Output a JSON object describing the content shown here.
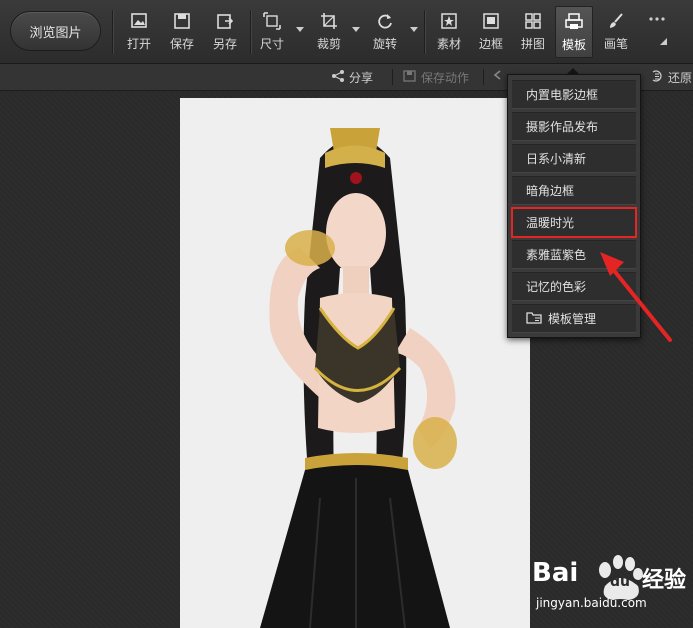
{
  "toolbar": {
    "browse_label": "浏览图片",
    "tools": [
      {
        "id": "open",
        "label": "打开",
        "icon": "image-open-icon"
      },
      {
        "id": "save",
        "label": "保存",
        "icon": "save-disk-icon"
      },
      {
        "id": "saveas",
        "label": "另存",
        "icon": "save-as-icon"
      },
      {
        "id": "size",
        "label": "尺寸",
        "icon": "resize-icon"
      },
      {
        "id": "crop",
        "label": "裁剪",
        "icon": "crop-icon"
      },
      {
        "id": "rotate",
        "label": "旋转",
        "icon": "rotate-icon"
      },
      {
        "id": "material",
        "label": "素材",
        "icon": "star-frame-icon"
      },
      {
        "id": "border",
        "label": "边框",
        "icon": "frame-icon"
      },
      {
        "id": "collage",
        "label": "拼图",
        "icon": "grid-icon"
      },
      {
        "id": "template",
        "label": "模板",
        "icon": "printer-template-icon"
      },
      {
        "id": "brush",
        "label": "画笔",
        "icon": "brush-icon"
      }
    ],
    "more_icon": "more-dots-icon"
  },
  "subbar": {
    "share_label": "分享",
    "save_action_label": "保存动作",
    "restore_label": "还原"
  },
  "template_menu": {
    "items": [
      {
        "label": "内置电影边框"
      },
      {
        "label": "摄影作品发布"
      },
      {
        "label": "日系小清新"
      },
      {
        "label": "暗角边框"
      },
      {
        "label": "温暖时光",
        "highlighted": true
      },
      {
        "label": "素雅蓝紫色"
      },
      {
        "label": "记忆的色彩"
      },
      {
        "label": "模板管理",
        "icon": "folder-manage-icon"
      }
    ]
  },
  "watermark": {
    "brand": "Bai",
    "brand2": "du",
    "cn": "经验",
    "url": "jingyan.baidu.com"
  },
  "colors": {
    "highlight": "#e52424",
    "arrow": "#e52424"
  }
}
